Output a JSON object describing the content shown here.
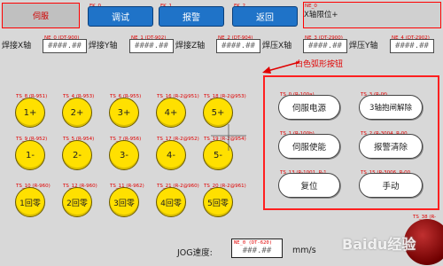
{
  "header": {
    "title": "伺服",
    "axis_limit_tag": "NE_0",
    "axis_limit": "X轴限位+"
  },
  "top_buttons": [
    {
      "tag": "FK_0",
      "label": "调试"
    },
    {
      "tag": "FK_1",
      "label": "报警"
    },
    {
      "tag": "FK_2",
      "label": "返回"
    }
  ],
  "weld_axes": [
    {
      "label": "焊接X轴",
      "tag": "NE_0 (DT-900)",
      "value": "####.##"
    },
    {
      "label": "焊接Y轴",
      "tag": "NE_1 (DT-902)",
      "value": "####.##"
    },
    {
      "label": "焊接Z轴",
      "tag": "NE_2 (DT-904)",
      "value": "####.##"
    },
    {
      "label": "焊压X轴",
      "tag": "NE_3 (DT-2900)",
      "value": "####.##"
    },
    {
      "label": "焊压Y轴",
      "tag": "NE_4 (DT-2902)",
      "value": "####.##"
    }
  ],
  "annotation": "白色弧形按钮",
  "jog_buttons": [
    {
      "tag": "TS_8 (R-951)",
      "label": "1+"
    },
    {
      "tag": "TS_4 (R-953)",
      "label": "2+"
    },
    {
      "tag": "TS_6 (R-955)",
      "label": "3+"
    },
    {
      "tag": "TS_16 (R-2@951)",
      "label": "4+"
    },
    {
      "tag": "TS_18 (R-2@953)",
      "label": "5+"
    },
    {
      "tag": "TS_9 (R-952)",
      "label": "1-"
    },
    {
      "tag": "TS_5 (R-954)",
      "label": "2-"
    },
    {
      "tag": "TS_7 (R-956)",
      "label": "3-"
    },
    {
      "tag": "TS_17 (R-2@952)",
      "label": "4-"
    },
    {
      "tag": "TS_19 (R-2@954)",
      "label": "5-"
    },
    {
      "tag": "TS_10 (R-960)",
      "label": "1回零"
    },
    {
      "tag": "TS_12 (R-960)",
      "label": "2回零"
    },
    {
      "tag": "TS_11 (R-962)",
      "label": "3回零"
    },
    {
      "tag": "TS_21 (R-2@960)",
      "label": "4回零"
    },
    {
      "tag": "TS_20 (R-2@961)",
      "label": "5回零"
    }
  ],
  "oval_buttons": [
    {
      "tag": "TS_0 (R-100a)",
      "label": "伺服电源"
    },
    {
      "tag": "TS_3 (R-0f)",
      "label": "3轴抱闸解除"
    },
    {
      "tag": "TS_1 (R-100b)",
      "label": "伺服使能"
    },
    {
      "tag": "TS_2 (R-3004, R-00",
      "label": "报警清除"
    },
    {
      "tag": "TS_13 (R-1001, R-1",
      "label": "复位"
    },
    {
      "tag": "TS_15 (R-3006, R-00",
      "label": "手动"
    }
  ],
  "bottom_corner_tag": "TS_38 (R-",
  "jog": {
    "label": "JOG速度:",
    "tag": "NE_0 (DT-620)",
    "value": "###.##",
    "unit": "mm/s"
  },
  "watermark": "Baidu经验",
  "colors": {
    "button_blue": "#1f73c8",
    "jog_yellow": "#ffe000",
    "highlight_red": "#ff2020"
  }
}
